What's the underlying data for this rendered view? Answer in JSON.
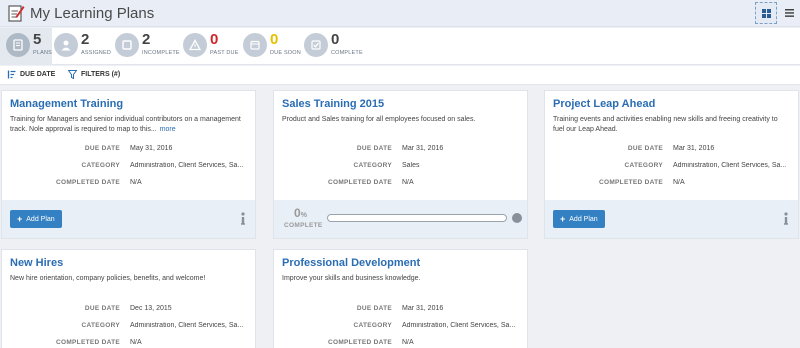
{
  "header": {
    "title": "My Learning Plans",
    "title_icon": "edit-note-icon",
    "view_grid_icon": "grid-view-icon",
    "view_list_icon": "list-view-icon"
  },
  "stats": [
    {
      "key": "plans",
      "value": "5",
      "label": "PLANS",
      "icon": "notebook-icon",
      "color": "#444444"
    },
    {
      "key": "assigned",
      "value": "2",
      "label": "ASSIGNED",
      "icon": "person-icon",
      "color": "#444444"
    },
    {
      "key": "incomplete",
      "value": "2",
      "label": "INCOMPLETE",
      "icon": "square-icon",
      "color": "#444444"
    },
    {
      "key": "past_due",
      "value": "0",
      "label": "PAST DUE",
      "icon": "warning-icon",
      "color": "#d0262a"
    },
    {
      "key": "due_soon",
      "value": "0",
      "label": "DUE SOON",
      "icon": "calendar-icon",
      "color": "#e6c000"
    },
    {
      "key": "complete",
      "value": "0",
      "label": "COMPLETE",
      "icon": "checkbox-icon",
      "color": "#444444"
    }
  ],
  "toolbar": {
    "sort_label": "DUE DATE",
    "filters_label": "FILTERS (#)"
  },
  "labels": {
    "due_date": "DUE DATE",
    "category": "CATEGORY",
    "completed_date": "COMPLETED DATE",
    "add_plan": "Add Plan",
    "complete": "COMPLETE",
    "more": "more"
  },
  "plans": [
    {
      "title": "Management Training",
      "description": "Training for Managers and senior individual contributors on a management track. Nole approval is required to map to this...",
      "has_more": true,
      "due_date": "May 31, 2016",
      "category": "Administration, Client Services, Sa...",
      "completed_date": "N/A",
      "footer": "add"
    },
    {
      "title": "Sales Training 2015",
      "description": "Product and Sales training for all employees focused on sales.",
      "has_more": false,
      "due_date": "Mar 31, 2016",
      "category": "Sales",
      "completed_date": "N/A",
      "footer": "progress",
      "progress_value": "0",
      "progress_unit": "%",
      "progress_fraction": 0
    },
    {
      "title": "Project Leap Ahead",
      "description": "Training events and activities enabling new skills and freeing creativity to fuel our Leap Ahead.",
      "has_more": false,
      "due_date": "Mar 31, 2016",
      "category": "Administration, Client Services, Sa...",
      "completed_date": "N/A",
      "footer": "add"
    },
    {
      "title": "New Hires",
      "description": "New hire orientation, company policies, benefits, and welcome!",
      "has_more": false,
      "due_date": "Dec 13, 2015",
      "category": "Administration, Client Services, Sa...",
      "completed_date": "N/A",
      "footer": "none"
    },
    {
      "title": "Professional Development",
      "description": "Improve your skills and business knowledge.",
      "has_more": false,
      "due_date": "Mar 31, 2016",
      "category": "Administration, Client Services, Sa...",
      "completed_date": "N/A",
      "footer": "none"
    }
  ]
}
